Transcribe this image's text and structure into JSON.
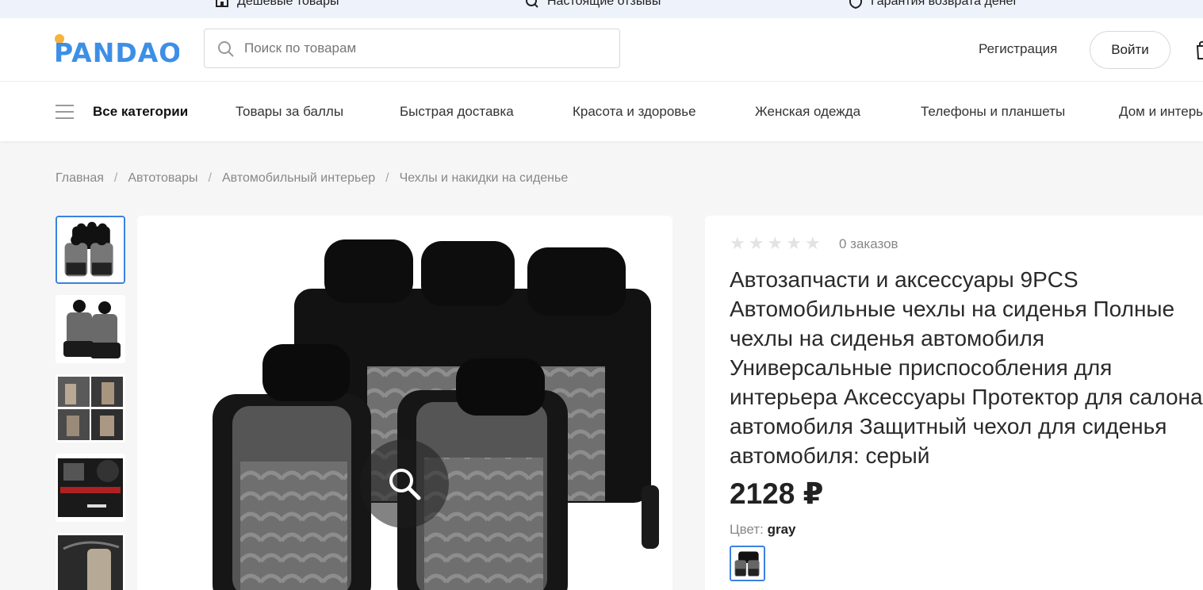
{
  "promo": {
    "items": [
      {
        "label": "Дешевые товары",
        "icon": "shop-icon"
      },
      {
        "label": "Настоящие отзывы",
        "icon": "review-icon"
      },
      {
        "label": "Гарантия возврата денег",
        "icon": "shield-icon"
      }
    ]
  },
  "header": {
    "logo_text": "PANDAO",
    "search_placeholder": "Поиск по товарам",
    "register_label": "Регистрация",
    "login_label": "Войти"
  },
  "nav": {
    "items": [
      "Все категории",
      "Товары за баллы",
      "Быстрая доставка",
      "Красота и здоровье",
      "Женская одежда",
      "Телефоны и планшеты",
      "Дом и интерь"
    ]
  },
  "breadcrumb": {
    "items": [
      "Главная",
      "Автотовары",
      "Автомобильный интерьер",
      "Чехлы и накидки на сиденье"
    ],
    "separator": "/"
  },
  "product": {
    "rating_stars": 0,
    "rating_max": 5,
    "orders": "0 заказов",
    "title": "Автозапчасти и аксессуары 9PCS Автомобильные чехлы на сиденья Полные чехлы на сиденья автомобиля Универсальные приспособления для интерьера Аксессуары Протектор для салона автомобиля Защитный чехол для сиденья автомобиля: серый",
    "price": "2128 ₽",
    "color_label": "Цвет:",
    "color_value": "gray"
  },
  "colors": {
    "accent": "#3b82e0",
    "logo_blue": "#3d8fe6",
    "logo_orange": "#f7b23b"
  }
}
